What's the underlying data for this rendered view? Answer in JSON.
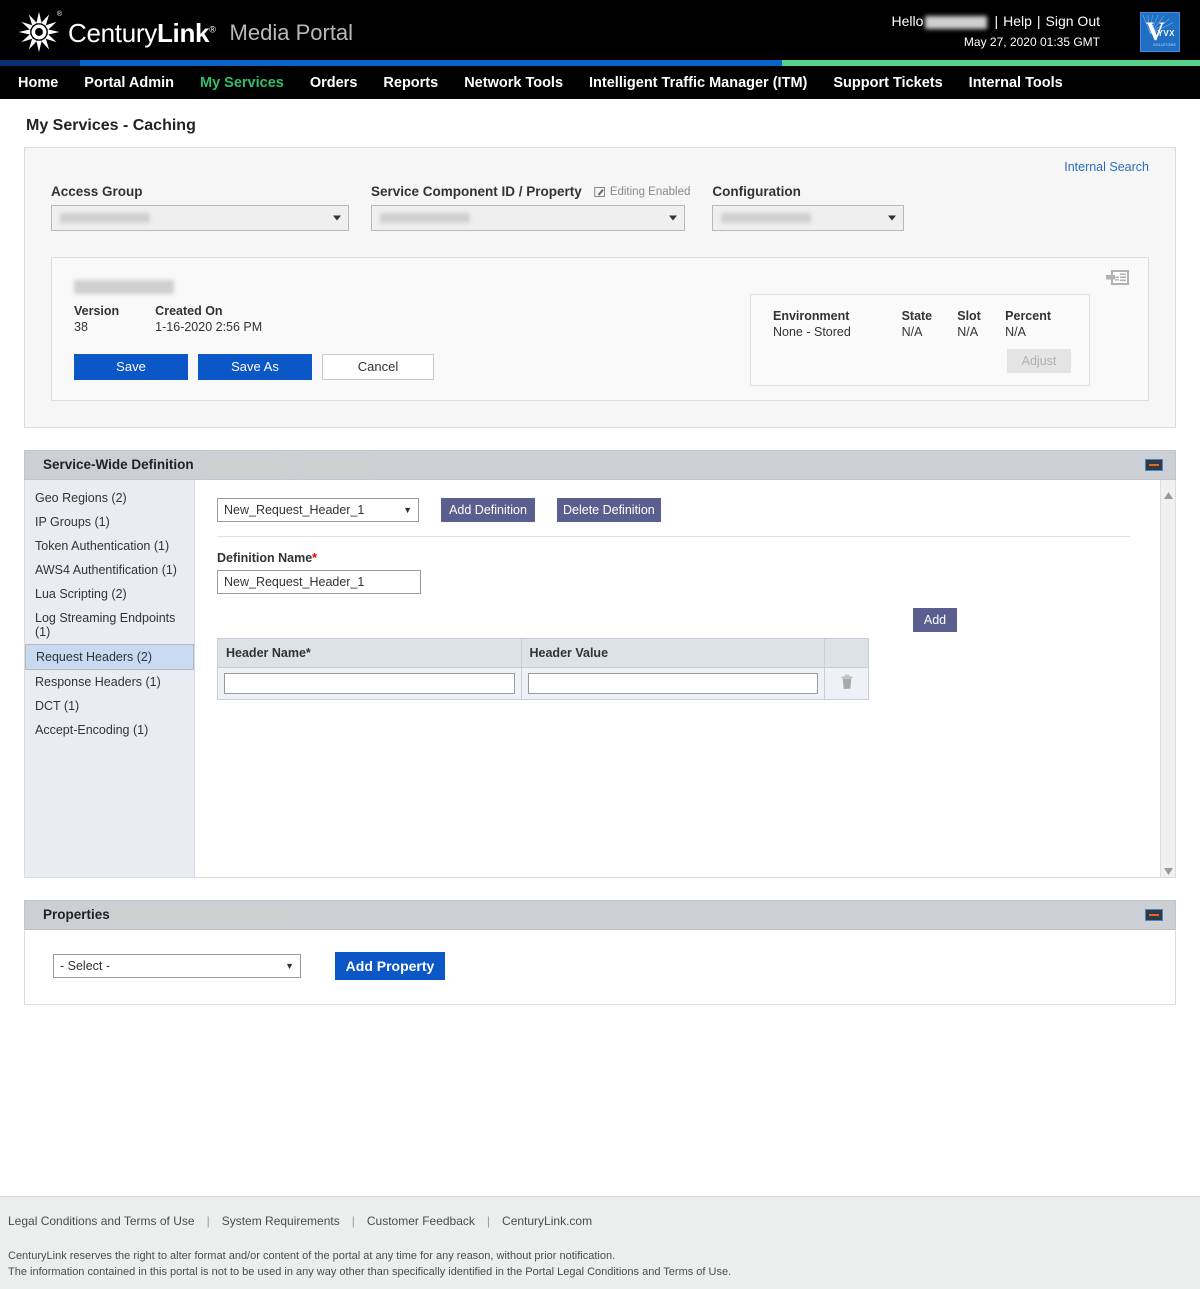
{
  "header": {
    "brand_century": "Century",
    "brand_link": "Link",
    "brand_reg": "®",
    "product": "Media Portal",
    "hello_label": "Hello",
    "user_redacted": "",
    "help_label": "Help",
    "signout_label": "Sign Out",
    "datetime": "May 27, 2020 01:35 GMT",
    "vyvx_v": "V",
    "vyvx_yvx": "YVX",
    "vyvx_tag": "SOLUTIONS"
  },
  "nav": {
    "items": [
      {
        "label": "Home",
        "active": false
      },
      {
        "label": "Portal Admin",
        "active": false
      },
      {
        "label": "My Services",
        "active": true
      },
      {
        "label": "Orders",
        "active": false
      },
      {
        "label": "Reports",
        "active": false
      },
      {
        "label": "Network Tools",
        "active": false
      },
      {
        "label": "Intelligent Traffic Manager (ITM)",
        "active": false
      },
      {
        "label": "Support Tickets",
        "active": false
      },
      {
        "label": "Internal Tools",
        "active": false
      }
    ]
  },
  "page": {
    "title": "My Services - Caching",
    "internal_search": "Internal Search"
  },
  "selectors": {
    "access_group_label": "Access Group",
    "access_group_value": "",
    "scid_label": "Service Component ID / Property",
    "editing_label": "Editing Enabled",
    "scid_value": "",
    "configuration_label": "Configuration",
    "configuration_value": ""
  },
  "config_card": {
    "name_redacted": "",
    "version_label": "Version",
    "version_value": "38",
    "created_label": "Created On",
    "created_value": "1-16-2020 2:56 PM",
    "save_label": "Save",
    "save_as_label": "Save As",
    "cancel_label": "Cancel",
    "environment_label": "Environment",
    "environment_value": "None - Stored",
    "state_label": "State",
    "state_value": "N/A",
    "slot_label": "Slot",
    "slot_value": "N/A",
    "percent_label": "Percent",
    "percent_value": "N/A",
    "adjust_label": "Adjust"
  },
  "service_wide": {
    "title": "Service-Wide Definition",
    "sidebar_items": [
      {
        "label": "Geo Regions (2)",
        "selected": false
      },
      {
        "label": "IP Groups (1)",
        "selected": false
      },
      {
        "label": "Token Authentication (1)",
        "selected": false
      },
      {
        "label": "AWS4 Authentification (1)",
        "selected": false
      },
      {
        "label": "Lua Scripting (2)",
        "selected": false
      },
      {
        "label": "Log Streaming Endpoints (1)",
        "selected": false
      },
      {
        "label": "Request Headers (2)",
        "selected": true
      },
      {
        "label": "Response Headers (1)",
        "selected": false
      },
      {
        "label": "DCT (1)",
        "selected": false
      },
      {
        "label": "Accept-Encoding (1)",
        "selected": false
      }
    ],
    "definition_select_value": "New_Request_Header_1",
    "add_definition_label": "Add Definition",
    "delete_definition_label": "Delete Definition",
    "definition_name_label": "Definition Name",
    "definition_name_required": "*",
    "definition_name_value": "New_Request_Header_1",
    "add_label": "Add",
    "table": {
      "columns": [
        "Header Name",
        "Header Value"
      ],
      "header_name_required": "*",
      "rows": [
        {
          "header_name": "",
          "header_value": ""
        }
      ]
    }
  },
  "properties": {
    "title": "Properties",
    "select_value": "- Select -",
    "add_property_label": "Add Property"
  },
  "footer": {
    "links": [
      "Legal Conditions and Terms of Use",
      "System Requirements",
      "Customer Feedback",
      "CenturyLink.com"
    ],
    "fine_line_1": "CenturyLink reserves the right to alter format and/or content of the portal at any time for any reason, without prior notification.",
    "fine_line_2": "The information contained in this portal is not to be used in any way other than specifically identified in the Portal Legal Conditions and Terms of Use."
  },
  "colors": {
    "brand_blue": "#0b57c8",
    "accent_green": "#2fbf6e",
    "slate_button": "#5a5f8f",
    "link_blue": "#2a6ebb"
  }
}
